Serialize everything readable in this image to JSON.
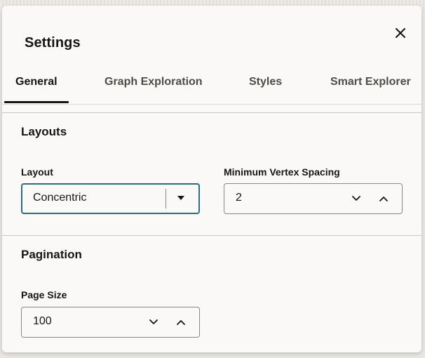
{
  "dialog": {
    "title": "Settings",
    "close_icon": "close-icon"
  },
  "tabs": [
    {
      "label": "General",
      "active": true
    },
    {
      "label": "Graph Exploration",
      "active": false
    },
    {
      "label": "Styles",
      "active": false
    },
    {
      "label": "Smart Explorer",
      "active": false
    }
  ],
  "layouts": {
    "title": "Layouts",
    "layout_label": "Layout",
    "layout_value": "Concentric",
    "spacing_label": "Minimum Vertex Spacing",
    "spacing_value": "2"
  },
  "pagination": {
    "title": "Pagination",
    "page_size_label": "Page Size",
    "page_size_value": "100"
  },
  "icons": {
    "dropdown": "caret-down-icon",
    "decrement": "chevron-down-icon",
    "increment": "chevron-up-icon"
  },
  "colors": {
    "focus_border": "#2b6f7a",
    "dialog_background": "#fbf9f8",
    "text": "#161513"
  }
}
